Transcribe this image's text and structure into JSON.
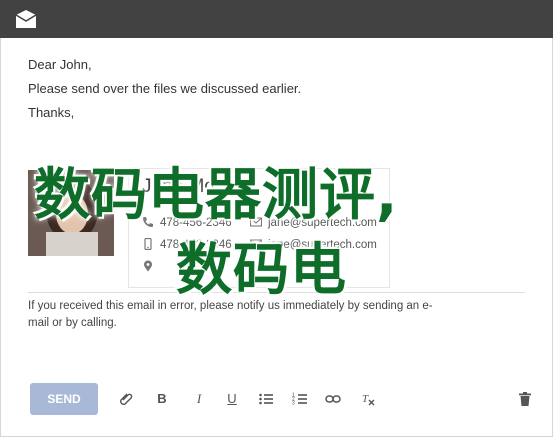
{
  "email": {
    "greeting": "Dear John,",
    "line2": "Please send over the files we discussed earlier.",
    "closing": "Thanks,"
  },
  "signature": {
    "name": "Jane Moore",
    "phone": "478-456-2346",
    "mobile": "478-456-2346",
    "email1": "jane@supertech.com",
    "email2": "jane@supertech.com"
  },
  "disclaimer": "If you received this email in error, please notify us immediately by sending an e-mail or by calling.",
  "overlay": {
    "line1": "数码电器测评,",
    "line2": "数码电"
  },
  "toolbar": {
    "send_label": "SEND",
    "bold_label": "B",
    "italic_label": "I",
    "underline_label": "U"
  },
  "colors": {
    "titlebar": "#424242",
    "send_button": "#a9b8d6",
    "overlay_text": "#0f6d2a"
  }
}
